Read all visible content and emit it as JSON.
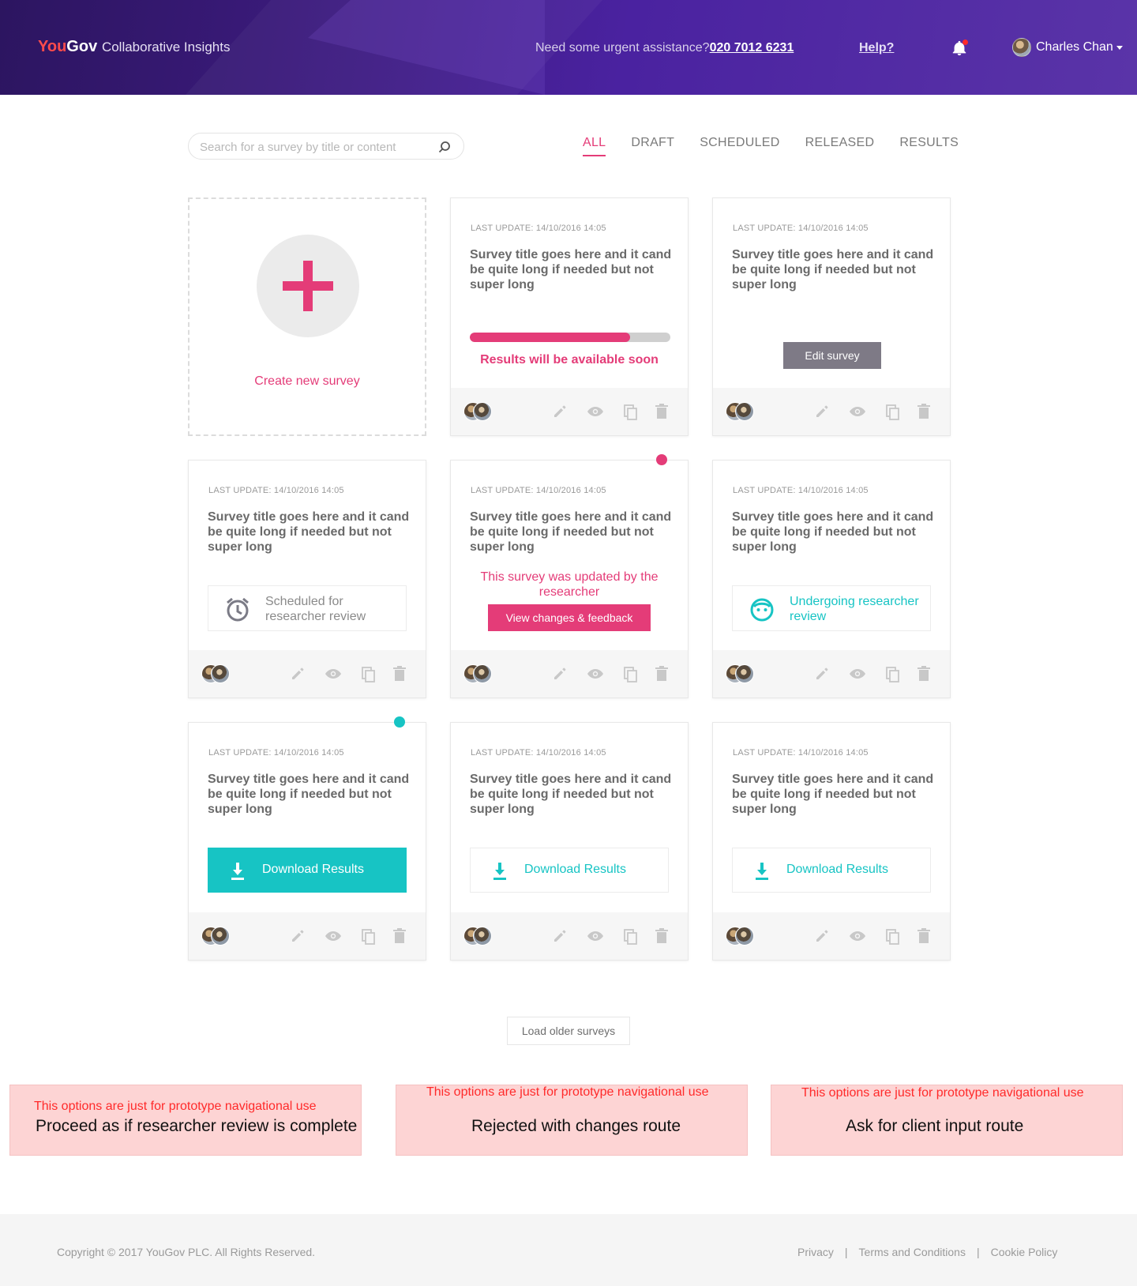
{
  "header": {
    "logo_you": "You",
    "logo_gov": "Gov",
    "logo_product": "Collaborative Insights",
    "assist_text": "Need some urgent assistance?",
    "assist_phone": "020 7012 6231",
    "help_label": "Help?",
    "user_name": "Charles Chan"
  },
  "search": {
    "placeholder": "Search for a survey by title or content"
  },
  "tabs": [
    {
      "label": "ALL",
      "active": true
    },
    {
      "label": "DRAFT"
    },
    {
      "label": "SCHEDULED"
    },
    {
      "label": "RELEASED"
    },
    {
      "label": "RESULTS"
    }
  ],
  "create_label": "Create new survey",
  "cards": [
    {
      "meta": "LAST UPDATE: 14/10/2016  14:05",
      "title": "Survey title goes here and it cand be quite long if needed but not super long",
      "progress": 0.8,
      "status": "Results will be available soon"
    },
    {
      "meta": "LAST UPDATE: 14/10/2016  14:05",
      "title": "Survey title goes here and it cand be quite long if needed but not super long",
      "button": "Edit survey"
    },
    {
      "meta": "LAST UPDATE: 14/10/2016  14:05",
      "title": "Survey title goes here and it cand be quite long if needed but not super long",
      "status": "Scheduled for researcher review"
    },
    {
      "meta": "LAST UPDATE: 14/10/2016  14:05",
      "title": "Survey title goes here and it cand be quite long if needed but not super long",
      "status": "This survey was updated by the researcher",
      "button": "View changes & feedback"
    },
    {
      "meta": "LAST UPDATE: 14/10/2016  14:05",
      "title": "Survey title goes here and it cand be quite long if needed but not super long",
      "status": "Undergoing researcher review"
    },
    {
      "meta": "LAST UPDATE: 14/10/2016  14:05",
      "title": "Survey title goes here and it cand be quite long if needed but not super long",
      "button": "Download Results"
    },
    {
      "meta": "LAST UPDATE: 14/10/2016  14:05",
      "title": "Survey title goes here and it cand be quite long if needed but not super long",
      "button": "Download Results"
    },
    {
      "meta": "LAST UPDATE: 14/10/2016  14:05",
      "title": "Survey title goes here and it cand be quite long if needed but not super long",
      "button": "Download Results"
    }
  ],
  "load_older": "Load older surveys",
  "proto": [
    {
      "note": "This options are just  for prototype navigational use",
      "action": "Proceed as if researcher review is complete"
    },
    {
      "note": "This options are just  for prototype navigational use",
      "action": "Rejected with changes route"
    },
    {
      "note": "This options are just  for prototype navigational use",
      "action": "Ask for client input route"
    }
  ],
  "footer": {
    "copyright": "Copyright © 2017 YouGov PLC. All Rights Reserved.",
    "links": [
      "Privacy",
      "Terms and Conditions",
      "Cookie Policy"
    ]
  },
  "colors": {
    "accent": "#e43c78",
    "teal": "#17c4c4",
    "header": "#3a1a7a"
  },
  "icons": [
    "search-icon",
    "bell-icon",
    "plus-icon",
    "edit-icon",
    "eye-icon",
    "copy-icon",
    "trash-icon",
    "alarm-clock-icon",
    "face-icon",
    "download-icon"
  ]
}
